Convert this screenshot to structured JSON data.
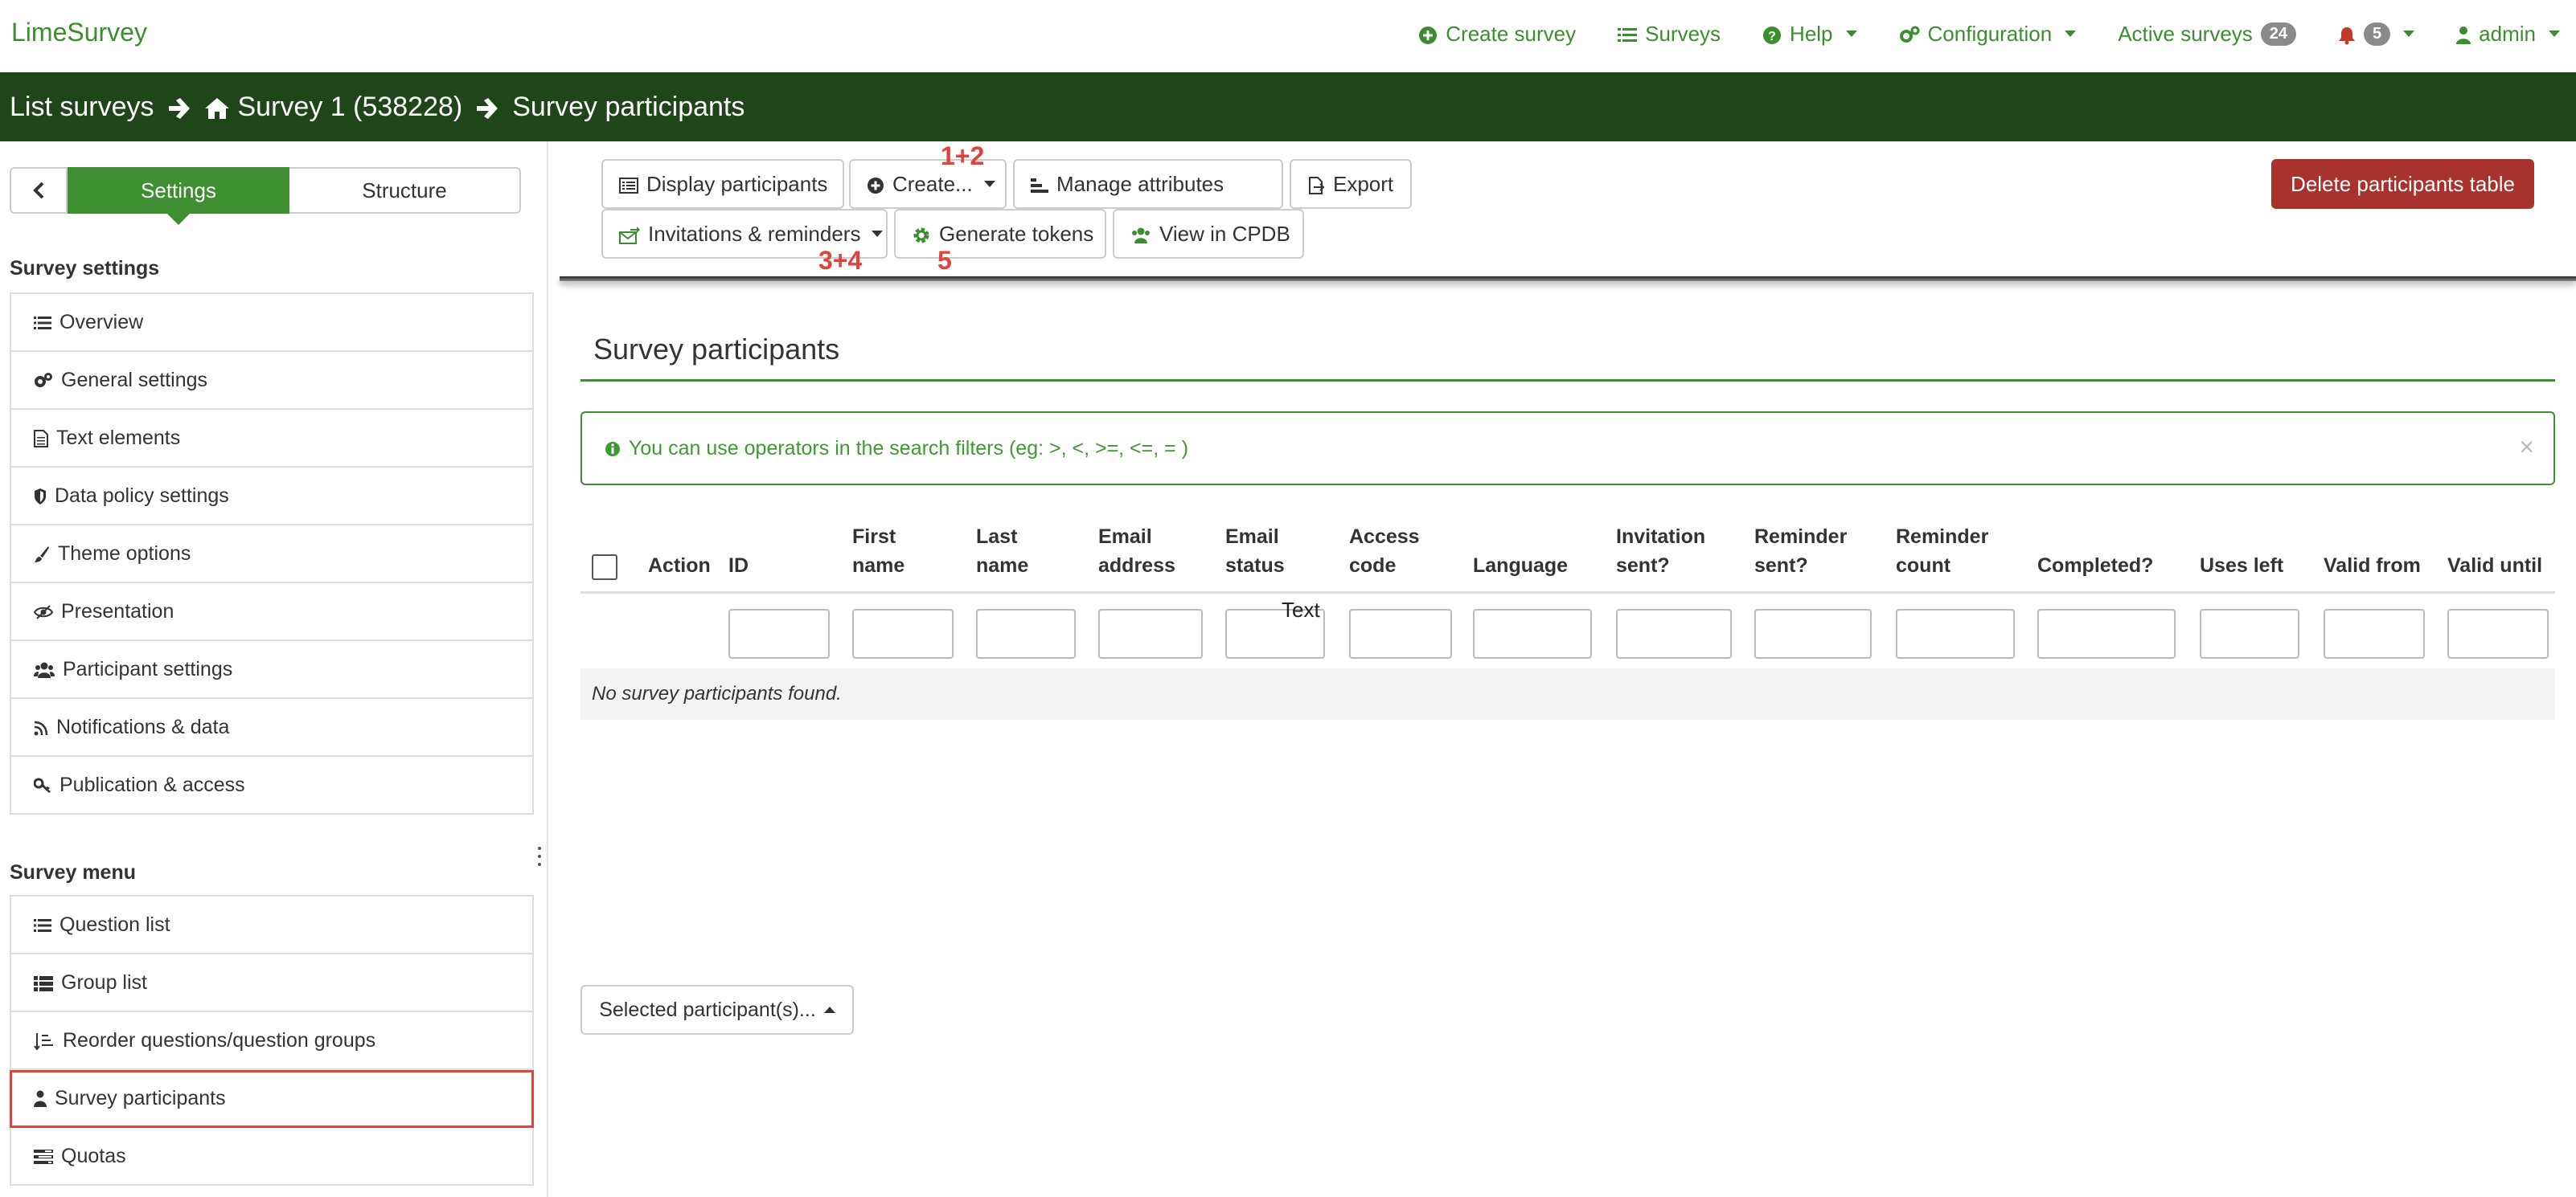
{
  "app": {
    "brand": "LimeSurvey"
  },
  "colors": {
    "brand_green": "#3c8d2f",
    "breadcrumb_bg": "#1e4619",
    "danger": "#a8322d",
    "annotation_red": "#e0433a"
  },
  "topnav": {
    "create_survey": "Create survey",
    "surveys": "Surveys",
    "help": "Help",
    "configuration": "Configuration",
    "active_surveys": "Active surveys",
    "active_surveys_count": "24",
    "notifications_count": "5",
    "user": "admin"
  },
  "breadcrumb": {
    "list_surveys": "List surveys",
    "survey": "Survey 1 (538228)",
    "current": "Survey participants"
  },
  "sidebar": {
    "tab_settings": "Settings",
    "tab_structure": "Structure",
    "settings_heading": "Survey settings",
    "settings_items": [
      {
        "label": "Overview",
        "icon": "list-icon"
      },
      {
        "label": "General settings",
        "icon": "gears-icon"
      },
      {
        "label": "Text elements",
        "icon": "file-text-icon"
      },
      {
        "label": "Data policy settings",
        "icon": "shield-icon"
      },
      {
        "label": "Theme options",
        "icon": "paintbrush-icon"
      },
      {
        "label": "Presentation",
        "icon": "eye-slash-icon"
      },
      {
        "label": "Participant settings",
        "icon": "users-icon"
      },
      {
        "label": "Notifications & data",
        "icon": "rss-icon"
      },
      {
        "label": "Publication & access",
        "icon": "key-icon"
      }
    ],
    "menu_heading": "Survey menu",
    "menu_items": [
      {
        "label": "Question list",
        "icon": "list-icon"
      },
      {
        "label": "Group list",
        "icon": "list-icon"
      },
      {
        "label": "Reorder questions/question groups",
        "icon": "sort-icon"
      },
      {
        "label": "Survey participants",
        "icon": "user-icon"
      },
      {
        "label": "Quotas",
        "icon": "tasks-icon"
      }
    ]
  },
  "toolbar": {
    "display_participants": "Display participants",
    "create": "Create...",
    "manage_attributes": "Manage attributes",
    "export": "Export",
    "invitations_reminders": "Invitations & reminders",
    "generate_tokens": "Generate tokens",
    "view_in_cpdb": "View in CPDB",
    "delete_table": "Delete participants table"
  },
  "annotations": {
    "create": "1+2",
    "invitations": "3+4",
    "generate": "5"
  },
  "main": {
    "title": "Survey participants",
    "info": "You can use operators in the search filters (eg: >, <, >=, <=, = )",
    "close": "×",
    "stray_text": "Text",
    "empty": "No survey participants found.",
    "selected_button": "Selected participant(s)..."
  },
  "table": {
    "columns": [
      {
        "key": "action",
        "l1": "",
        "l2": "Action"
      },
      {
        "key": "id",
        "l1": "",
        "l2": "ID"
      },
      {
        "key": "firstname",
        "l1": "First",
        "l2": "name"
      },
      {
        "key": "lastname",
        "l1": "Last",
        "l2": "name"
      },
      {
        "key": "email",
        "l1": "Email",
        "l2": "address"
      },
      {
        "key": "emailstatus",
        "l1": "Email",
        "l2": "status"
      },
      {
        "key": "access",
        "l1": "Access",
        "l2": "code"
      },
      {
        "key": "language",
        "l1": "",
        "l2": "Language"
      },
      {
        "key": "invsent",
        "l1": "Invitation",
        "l2": "sent?"
      },
      {
        "key": "remsent",
        "l1": "Reminder",
        "l2": "sent?"
      },
      {
        "key": "remcount",
        "l1": "Reminder",
        "l2": "count"
      },
      {
        "key": "completed",
        "l1": "",
        "l2": "Completed?"
      },
      {
        "key": "usesleft",
        "l1": "",
        "l2": "Uses left"
      },
      {
        "key": "validfrom",
        "l1": "",
        "l2": "Valid from"
      },
      {
        "key": "validuntil",
        "l1": "",
        "l2": "Valid until"
      }
    ]
  }
}
